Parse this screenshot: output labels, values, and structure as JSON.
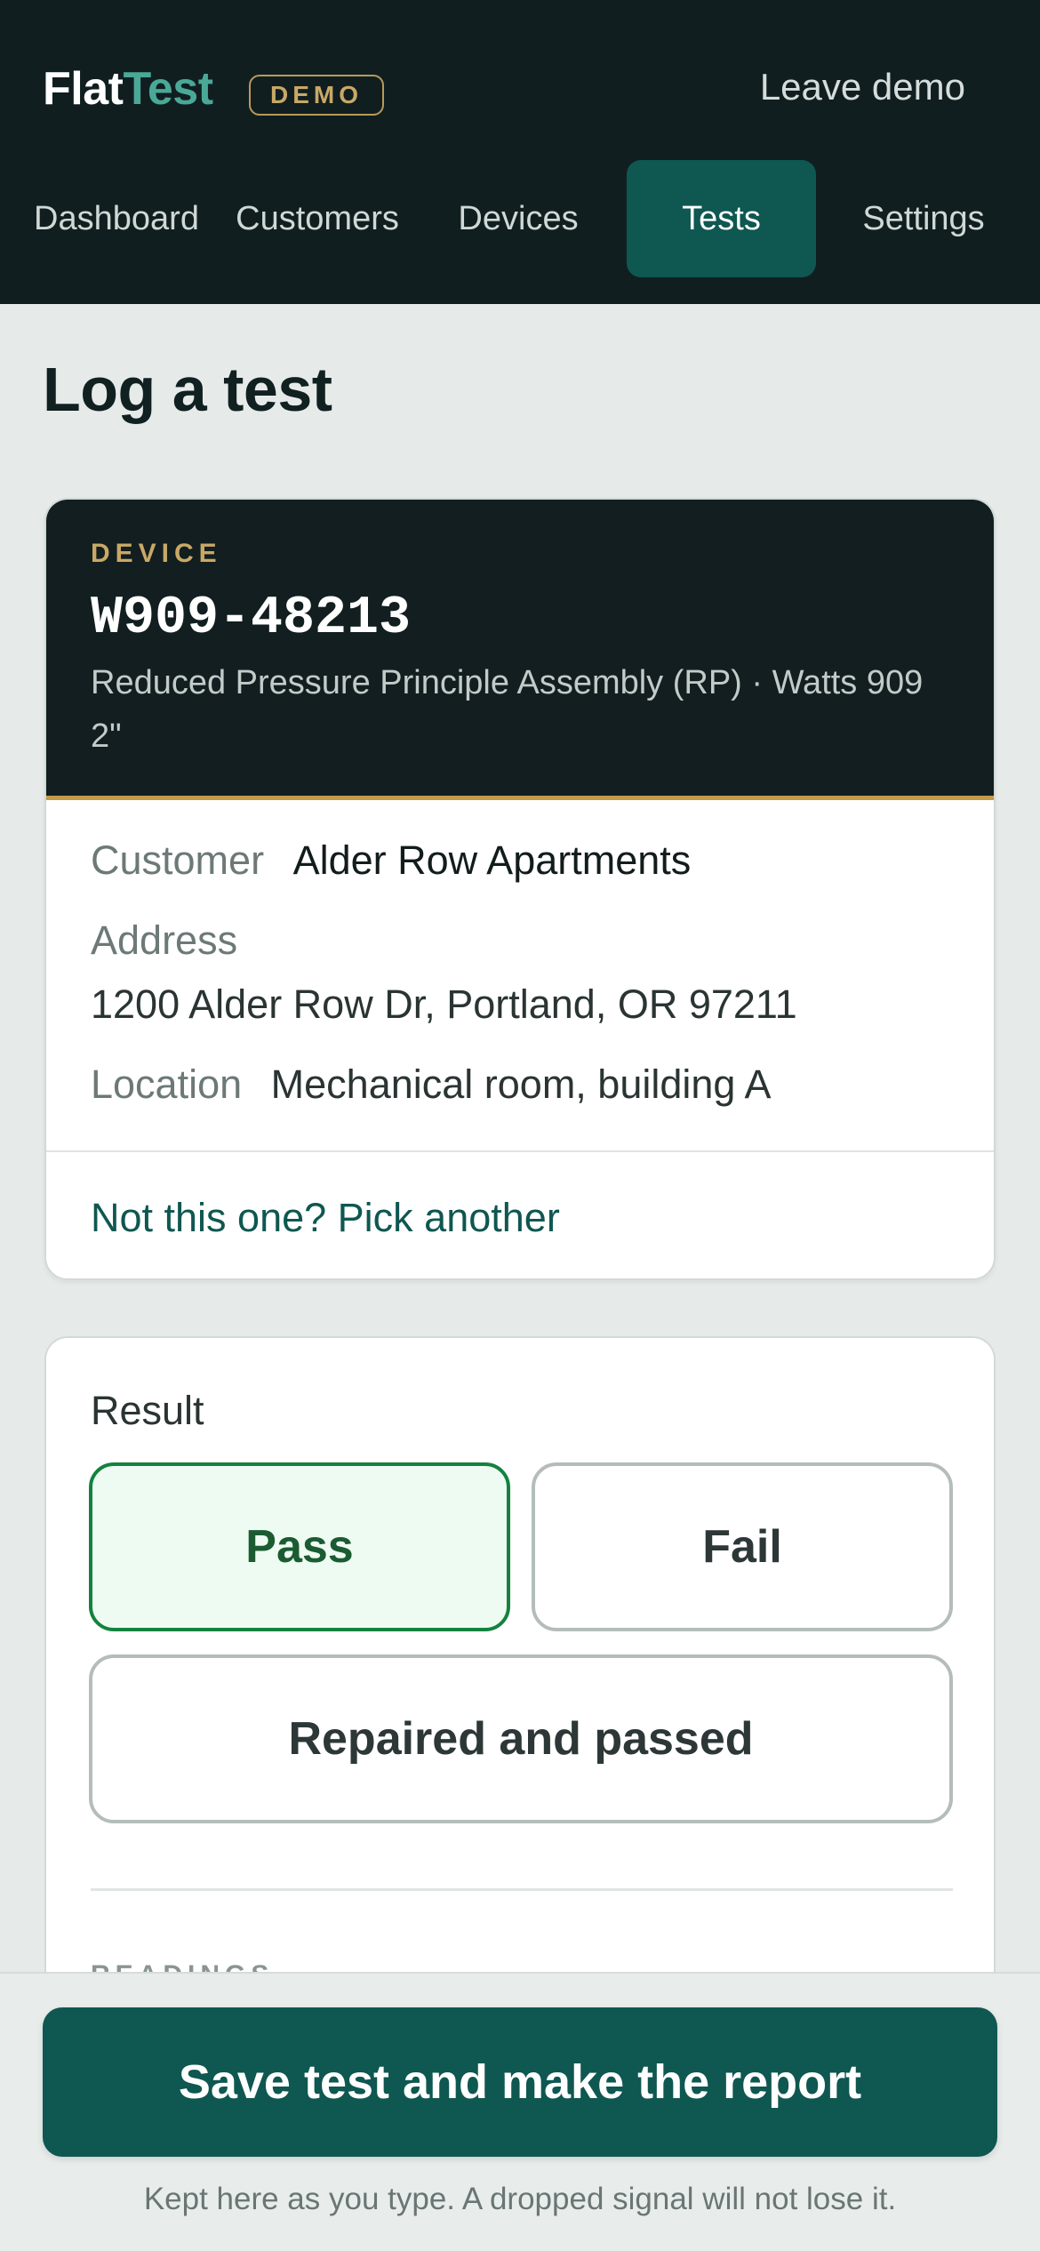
{
  "header": {
    "brand_part1": "Flat",
    "brand_part2": "Test",
    "demo_badge": "DEMO",
    "leave_demo": "Leave demo"
  },
  "nav": {
    "tabs": [
      {
        "label": "Dashboard"
      },
      {
        "label": "Customers"
      },
      {
        "label": "Devices"
      },
      {
        "label": "Tests",
        "active": true
      },
      {
        "label": "Settings"
      }
    ]
  },
  "page": {
    "title": "Log a test"
  },
  "device": {
    "kicker": "DEVICE",
    "id": "W909-48213",
    "description": "Reduced Pressure Principle Assembly (RP) · Watts 909 2\"",
    "customer_label": "Customer",
    "customer_value": "Alder Row Apartments",
    "address_label": "Address",
    "address_value": "1200 Alder Row Dr, Portland, OR 97211",
    "location_label": "Location",
    "location_value": "Mechanical room, building A",
    "pick_another": "Not this one? Pick another"
  },
  "result": {
    "label": "Result",
    "options": [
      {
        "label": "Pass",
        "selected": true
      },
      {
        "label": "Fail",
        "selected": false
      },
      {
        "label": "Repaired and passed",
        "selected": false
      }
    ],
    "readings_kicker": "READINGS"
  },
  "footer": {
    "save_label": "Save test and make the report",
    "hint": "Kept here as you type. A dropped signal will not lose it."
  },
  "colors": {
    "header_bg": "#111e20",
    "accent_teal": "#0f5751",
    "brand_teal": "#4aa897",
    "gold": "#c9a866",
    "pass_green": "#13823f"
  }
}
